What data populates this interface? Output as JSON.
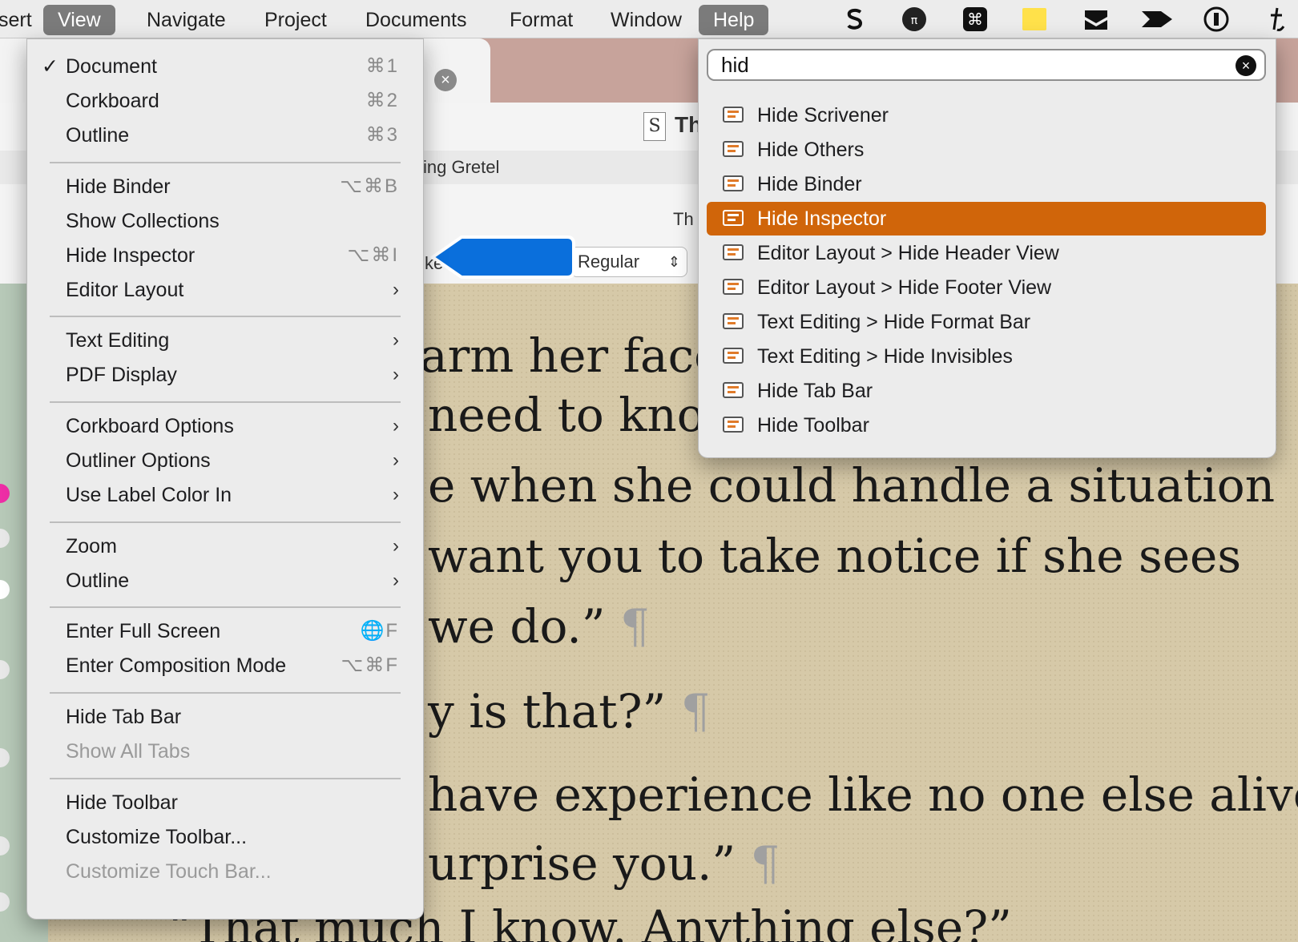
{
  "menubar": {
    "items": [
      "sert",
      "View",
      "Navigate",
      "Project",
      "Documents",
      "Format",
      "Window",
      "Help"
    ],
    "tray_icons": [
      "scrivener-s-icon",
      "timer-icon",
      "command-icon",
      "sticky-note-icon",
      "inbox-tray-icon",
      "arrow-forward-icon",
      "password-manager-icon",
      "typing-icon"
    ]
  },
  "view_menu": {
    "items": [
      {
        "label": "Document",
        "shortcut": "⌘1",
        "checked": "✓"
      },
      {
        "label": "Corkboard",
        "shortcut": "⌘2"
      },
      {
        "label": "Outline",
        "shortcut": "⌘3"
      },
      {
        "label": "Hide Binder",
        "shortcut": "⌥⌘B"
      },
      {
        "label": "Show Collections"
      },
      {
        "label": "Hide Inspector",
        "shortcut": "⌥⌘I"
      },
      {
        "label": "Editor Layout",
        "submenu": "›"
      },
      {
        "label": "Text Editing",
        "submenu": "›"
      },
      {
        "label": "PDF Display",
        "submenu": "›"
      },
      {
        "label": "Corkboard Options",
        "submenu": "›"
      },
      {
        "label": "Outliner Options",
        "submenu": "›"
      },
      {
        "label": "Use Label Color In",
        "submenu": "›"
      },
      {
        "label": "Zoom",
        "submenu": "›"
      },
      {
        "label": "Outline",
        "submenu": "›"
      },
      {
        "label": "Enter Full Screen",
        "shortcut": "🌐F"
      },
      {
        "label": "Enter Composition Mode",
        "shortcut": "⌥⌘F"
      },
      {
        "label": "Hide Tab Bar"
      },
      {
        "label": "Show All Tabs",
        "disabled": true
      },
      {
        "label": "Hide Toolbar"
      },
      {
        "label": "Customize Toolbar..."
      },
      {
        "label": "Customize Touch Bar...",
        "disabled": true
      }
    ]
  },
  "help_menu": {
    "search_value": "hid",
    "results": [
      "Hide Scrivener",
      "Hide Others",
      "Hide Binder",
      "Hide Inspector",
      "Editor Layout > Hide Header View",
      "Editor Layout > Hide Footer View",
      "Text Editing > Hide Format Bar",
      "Text Editing > Hide Invisibles",
      "Hide Tab Bar",
      "Hide Toolbar"
    ],
    "selected_result": "Hide Inspector"
  },
  "background": {
    "doc_title": "Th",
    "header_text": "ing Gretel",
    "ruler_text": "Th",
    "font_style": "Regular",
    "partial_field": "ke",
    "prose": [
      "arm her face,",
      "need to kno",
      "e when she could handle a situation",
      "want you to take notice if she sees",
      "we do.”",
      "y is that?”",
      "have experience like no one else alive,",
      "urprise you.”",
      "“That much I know. Anything else?”"
    ],
    "pilcrow": "¶"
  },
  "colors": {
    "accent": "#d0650a",
    "callout": "#0a6fdc"
  }
}
